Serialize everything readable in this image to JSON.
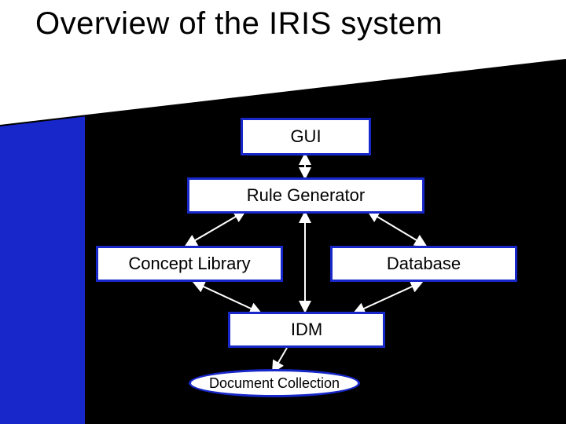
{
  "slide": {
    "title": "Overview of the IRIS system",
    "nodes": {
      "gui": "GUI",
      "rule_generator": "Rule Generator",
      "concept_library": "Concept Library",
      "database": "Database",
      "idm": "IDM",
      "document_collection": "Document Collection"
    },
    "colors": {
      "accent_blue": "#1727c9",
      "black": "#000000",
      "white": "#ffffff"
    }
  }
}
